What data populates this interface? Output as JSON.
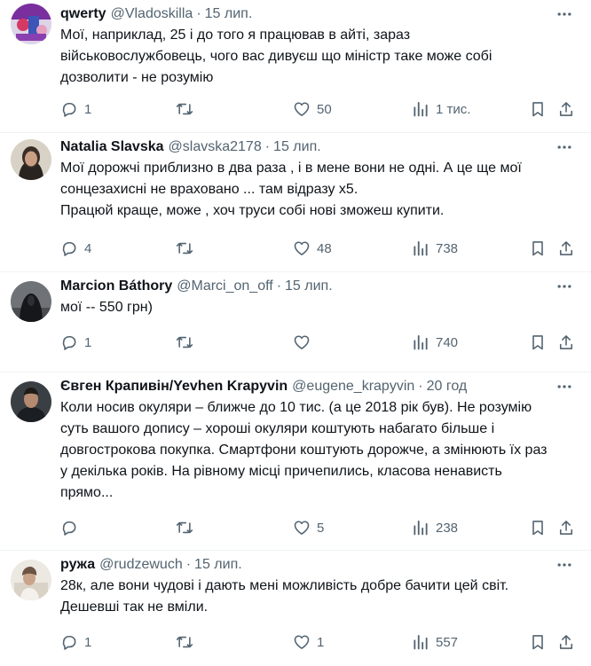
{
  "more_icon": "more-horizontal-icon",
  "icons": {
    "reply": "reply-icon",
    "retweet": "retweet-icon",
    "like": "heart-icon",
    "views": "views-icon",
    "bookmark": "bookmark-icon",
    "share": "share-icon"
  },
  "colors": {
    "text": "#0f1419",
    "secondary": "#536471",
    "divider": "#eff3f4",
    "background": "#ffffff"
  },
  "tweets": [
    {
      "display_name": "qwerty",
      "handle": "@Vladoskilla",
      "dot": "·",
      "time": "15 лип.",
      "text": "Мої, наприклад, 25 і до того я працював в айті, зараз\nвійськовослужбовець, чого вас дивуєш що міністр таке може собі\nдозволити - не розумію",
      "replies": "1",
      "retweets": "",
      "likes": "50",
      "views": "1 тис."
    },
    {
      "display_name": "Natalia Slavska",
      "handle": "@slavska2178",
      "dot": "·",
      "time": "15 лип.",
      "text": "Мої дорожчі приблизно в два раза , і в мене вони не одні. А це ще мої\nсонцезахисні не враховано ... там відразу х5.\nПрацюй краще, може , хоч труси собі нові зможеш купити.",
      "replies": "4",
      "retweets": "",
      "likes": "48",
      "views": "738"
    },
    {
      "display_name": "Marcion Báthory",
      "handle": "@Marci_on_off",
      "dot": "·",
      "time": "15 лип.",
      "text": "мої -- 550 грн)",
      "replies": "1",
      "retweets": "",
      "likes": "",
      "views": "740"
    },
    {
      "display_name": "Євген Крапивін/Yevhen Krapyvin",
      "handle": "@eugene_krapyvin",
      "dot": "·",
      "time": "20 год",
      "text": "Коли носив окуляри – ближче до 10 тис. (а це 2018 рік був). Не розумію\nсуть вашого допису – хороші окуляри коштують набагато більше і\nдовгострокова покупка. Смартфони коштують дорожче, а змінюють їх раз\nу декілька років. На рівному місці причепились, класова ненависть\nпрямо...",
      "replies": "",
      "retweets": "",
      "likes": "5",
      "views": "238"
    },
    {
      "display_name": "ружа",
      "handle": "@rudzewuch",
      "dot": "·",
      "time": "15 лип.",
      "text": "28к, але вони чудові і дають мені можливість добре бачити цей світ.\nДешевші так не вміли.",
      "replies": "1",
      "retweets": "",
      "likes": "1",
      "views": "557"
    }
  ]
}
